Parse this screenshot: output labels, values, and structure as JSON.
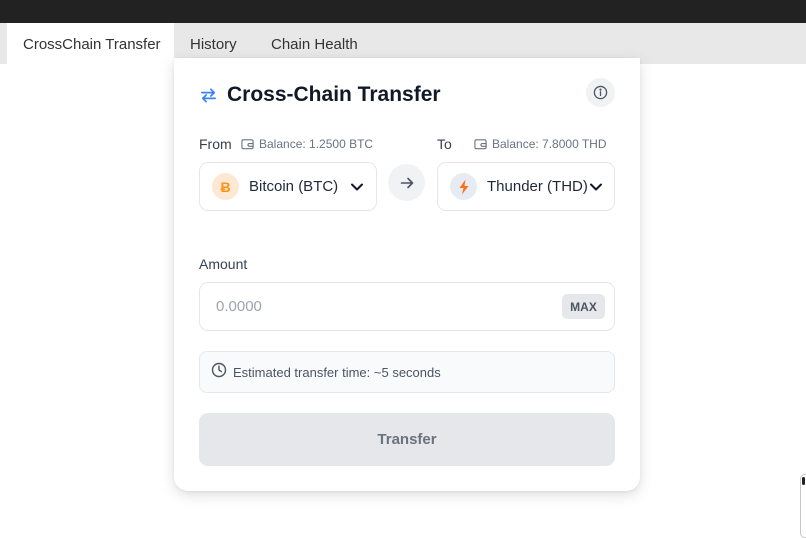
{
  "tabs": [
    {
      "label": "CrossChain Transfer",
      "active": true
    },
    {
      "label": "History",
      "active": false
    },
    {
      "label": "Chain Health",
      "active": false
    }
  ],
  "card": {
    "title": "Cross-Chain Transfer",
    "title_icon": "swap-arrows-icon",
    "info_icon": "info-icon"
  },
  "from": {
    "label": "From",
    "balance": "Balance: 1.2500 BTC",
    "coin_symbol": "Ƀ",
    "selected": "Bitcoin (BTC)"
  },
  "to": {
    "label": "To",
    "balance": "Balance: 7.8000 THD",
    "coin_icon": "lightning-icon",
    "selected": "Thunder (THD)"
  },
  "amount": {
    "label": "Amount",
    "placeholder": "0.0000",
    "value": "",
    "max_label": "MAX"
  },
  "estimate": {
    "text": "Estimated transfer time: ~5 seconds",
    "icon": "clock-icon"
  },
  "transfer_label": "Transfer",
  "colors": {
    "accent": "#3b82f6",
    "btc": "#f7931a",
    "thd": "#f97316",
    "disabled": "#e5e7eb"
  }
}
